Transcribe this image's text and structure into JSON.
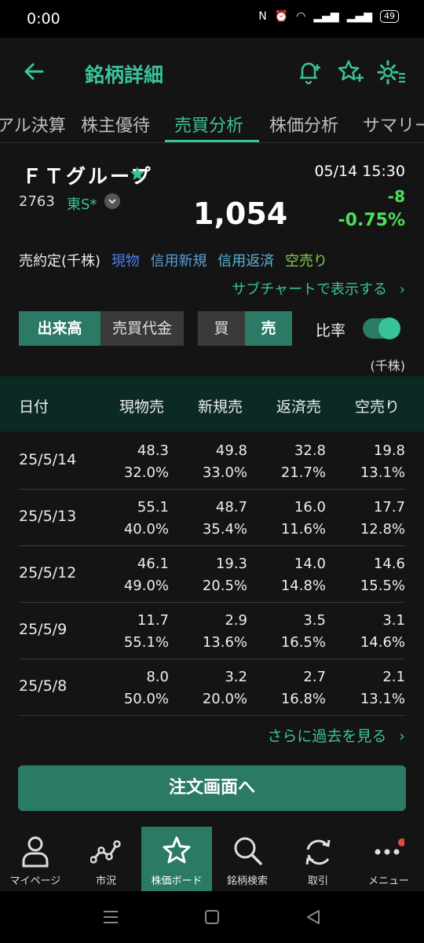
{
  "status": {
    "time": "0:00",
    "battery": "49"
  },
  "header": {
    "title": "銘柄詳細"
  },
  "tabs": [
    {
      "label": "アル決算"
    },
    {
      "label": "株主優待"
    },
    {
      "label": "売買分析"
    },
    {
      "label": "株価分析"
    },
    {
      "label": "サマリー"
    }
  ],
  "stock": {
    "name": "ＦＴグループ",
    "code": "2763",
    "market": "東S*",
    "price": "1,054",
    "datetime": "05/14 15:30",
    "change": "-8",
    "change_pct": "-0.75%"
  },
  "legend": {
    "prefix": "売約定(千株)",
    "items": [
      {
        "label": "現物",
        "color": "#4a7fe6"
      },
      {
        "label": "信用新規",
        "color": "#5a9bd8"
      },
      {
        "label": "信用返済",
        "color": "#5ab2d8"
      },
      {
        "label": "空売り",
        "color": "#7fd04a"
      }
    ]
  },
  "subchart_link": "サブチャートで表示する",
  "toggles": {
    "volume": "出来高",
    "value": "売買代金",
    "buy": "買",
    "sell": "売",
    "ratio": "比率",
    "unit": "(千株)"
  },
  "table": {
    "headers": [
      "日付",
      "現物売",
      "新規売",
      "返済売",
      "空売り"
    ],
    "rows": [
      {
        "date": "25/5/14",
        "v": [
          "48.3",
          "49.8",
          "32.8",
          "19.8"
        ],
        "p": [
          "32.0%",
          "33.0%",
          "21.7%",
          "13.1%"
        ]
      },
      {
        "date": "25/5/13",
        "v": [
          "55.1",
          "48.7",
          "16.0",
          "17.7"
        ],
        "p": [
          "40.0%",
          "35.4%",
          "11.6%",
          "12.8%"
        ]
      },
      {
        "date": "25/5/12",
        "v": [
          "46.1",
          "19.3",
          "14.0",
          "14.6"
        ],
        "p": [
          "49.0%",
          "20.5%",
          "14.8%",
          "15.5%"
        ]
      },
      {
        "date": "25/5/9",
        "v": [
          "11.7",
          "2.9",
          "3.5",
          "3.1"
        ],
        "p": [
          "55.1%",
          "13.6%",
          "16.5%",
          "14.6%"
        ]
      },
      {
        "date": "25/5/8",
        "v": [
          "8.0",
          "3.2",
          "2.7",
          "2.1"
        ],
        "p": [
          "50.0%",
          "20.0%",
          "16.8%",
          "13.1%"
        ]
      }
    ]
  },
  "more_link": "さらに過去を見る",
  "order_button": "注文画面へ",
  "tabbar": [
    {
      "label": "マイページ",
      "icon": "person-icon"
    },
    {
      "label": "市況",
      "icon": "market-line-icon"
    },
    {
      "label": "株価ボード",
      "icon": "star-icon"
    },
    {
      "label": "銘柄検索",
      "icon": "search-icon"
    },
    {
      "label": "取引",
      "icon": "refresh-icon"
    },
    {
      "label": "メニュー",
      "icon": "more-icon"
    }
  ],
  "colors": {
    "accent": "#39c39a",
    "accent_dark": "#2b7a66",
    "up_green": "#4ce05a"
  }
}
